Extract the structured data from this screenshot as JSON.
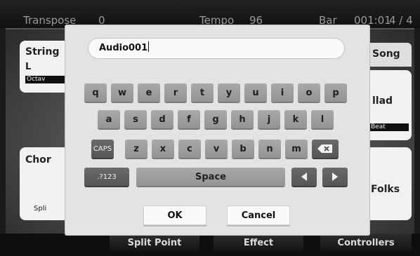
{
  "status": {
    "transpose_label": "Transpose",
    "transpose_value": "0",
    "tempo_label": "Tempo",
    "tempo_value": "96",
    "bar_label": "Bar",
    "bar_value": "001:01",
    "time_signature": "4 / 4"
  },
  "background": {
    "panel_string": {
      "title": "String",
      "sub": "L",
      "box": "Octav"
    },
    "panel_chord": {
      "title": "Chor",
      "sub": "Spli"
    },
    "panel_song_tab": "Song",
    "panel_ballad": {
      "title": "llad",
      "box": "Beat"
    },
    "panel_folks": {
      "title": "Folks"
    },
    "tabs": [
      "Split Point",
      "Effect",
      "Controllers"
    ]
  },
  "dialog": {
    "input_value": "Audio001",
    "rows": [
      [
        "q",
        "w",
        "e",
        "r",
        "t",
        "y",
        "u",
        "i",
        "o",
        "p"
      ],
      [
        "a",
        "s",
        "d",
        "f",
        "g",
        "h",
        "j",
        "k",
        "l"
      ],
      [
        "z",
        "x",
        "c",
        "v",
        "b",
        "n",
        "m"
      ]
    ],
    "caps_label": "CAPS",
    "numeric_label": ".?123",
    "space_label": "Space",
    "ok_label": "OK",
    "cancel_label": "Cancel",
    "icons": {
      "backspace": "backspace-icon",
      "arrow_left": "arrow-left-icon",
      "arrow_right": "arrow-right-icon"
    }
  }
}
